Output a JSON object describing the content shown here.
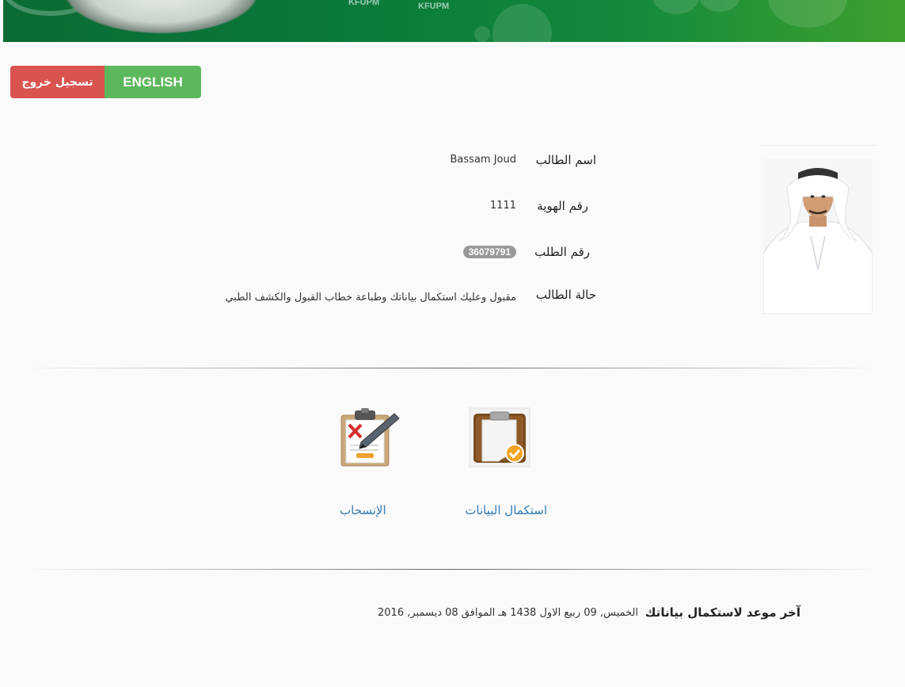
{
  "header": {
    "banner_text_1": "KFUPM",
    "banner_text_2": "KFUPM"
  },
  "toolbar": {
    "logout_label": "تسجيل خروج",
    "language_label": "ENGLISH"
  },
  "student": {
    "name_label": "اسم الطالب",
    "name_value": "Bassam Joud",
    "id_label": "رقم الهوية",
    "id_value": "1111",
    "application_label": "رقم الطلب",
    "application_value": "36079791",
    "status_label": "حالة الطالب",
    "status_value": "مقبول وعليك استكمال بياناتك وطباعة خطاب القبول والكشف الطبي"
  },
  "actions": [
    {
      "label": "استكمال البيانات",
      "icon": "clipboard-check-icon"
    },
    {
      "label": "الإنسحاب",
      "icon": "withdraw-clipboard-icon"
    }
  ],
  "deadline": {
    "label": "آخر موعد لاستكمال بياناتك",
    "value": "الخميس, 09 ربيع الاول 1438 هـ الموافق 08 ديسمبر, 2016"
  },
  "colors": {
    "logout": "#d9534f",
    "language": "#5cb85c",
    "link": "#337ab7",
    "banner": "#0b7a3b",
    "badge": "#999999"
  }
}
